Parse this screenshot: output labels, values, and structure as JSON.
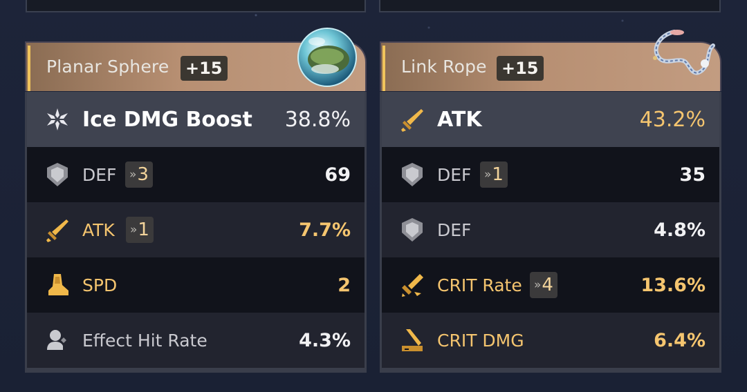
{
  "left": {
    "title": "Planar Sphere",
    "level": "+15",
    "icon": "planar-sphere-art",
    "main": {
      "name": "Ice DMG Boost",
      "value": "38.8%",
      "icon": "ice-element-icon"
    },
    "subs": [
      {
        "name": "DEF",
        "value": "69",
        "badge": "3",
        "icon": "shield-icon",
        "gold": false
      },
      {
        "name": "ATK",
        "value": "7.7%",
        "badge": "1",
        "icon": "sword-icon",
        "gold": true
      },
      {
        "name": "SPD",
        "value": "2",
        "badge": "",
        "icon": "boot-icon",
        "gold": true
      },
      {
        "name": "Effect Hit Rate",
        "value": "4.3%",
        "badge": "",
        "icon": "effect-hit-icon",
        "gold": false
      }
    ]
  },
  "right": {
    "title": "Link Rope",
    "level": "+15",
    "icon": "link-rope-art",
    "main": {
      "name": "ATK",
      "value": "43.2%",
      "icon": "sword-icon"
    },
    "subs": [
      {
        "name": "DEF",
        "value": "35",
        "badge": "1",
        "icon": "shield-icon",
        "gold": false
      },
      {
        "name": "DEF",
        "value": "4.8%",
        "badge": "",
        "icon": "shield-icon",
        "gold": false
      },
      {
        "name": "CRIT Rate",
        "value": "13.6%",
        "badge": "4",
        "icon": "crit-rate-icon",
        "gold": true
      },
      {
        "name": "CRIT DMG",
        "value": "6.4%",
        "badge": "",
        "icon": "crit-dmg-icon",
        "gold": true
      }
    ]
  },
  "chevron": "»",
  "colors": {
    "gold": "#f5c56f",
    "header_accent": "#f0c45c",
    "background": "#1b2236"
  }
}
